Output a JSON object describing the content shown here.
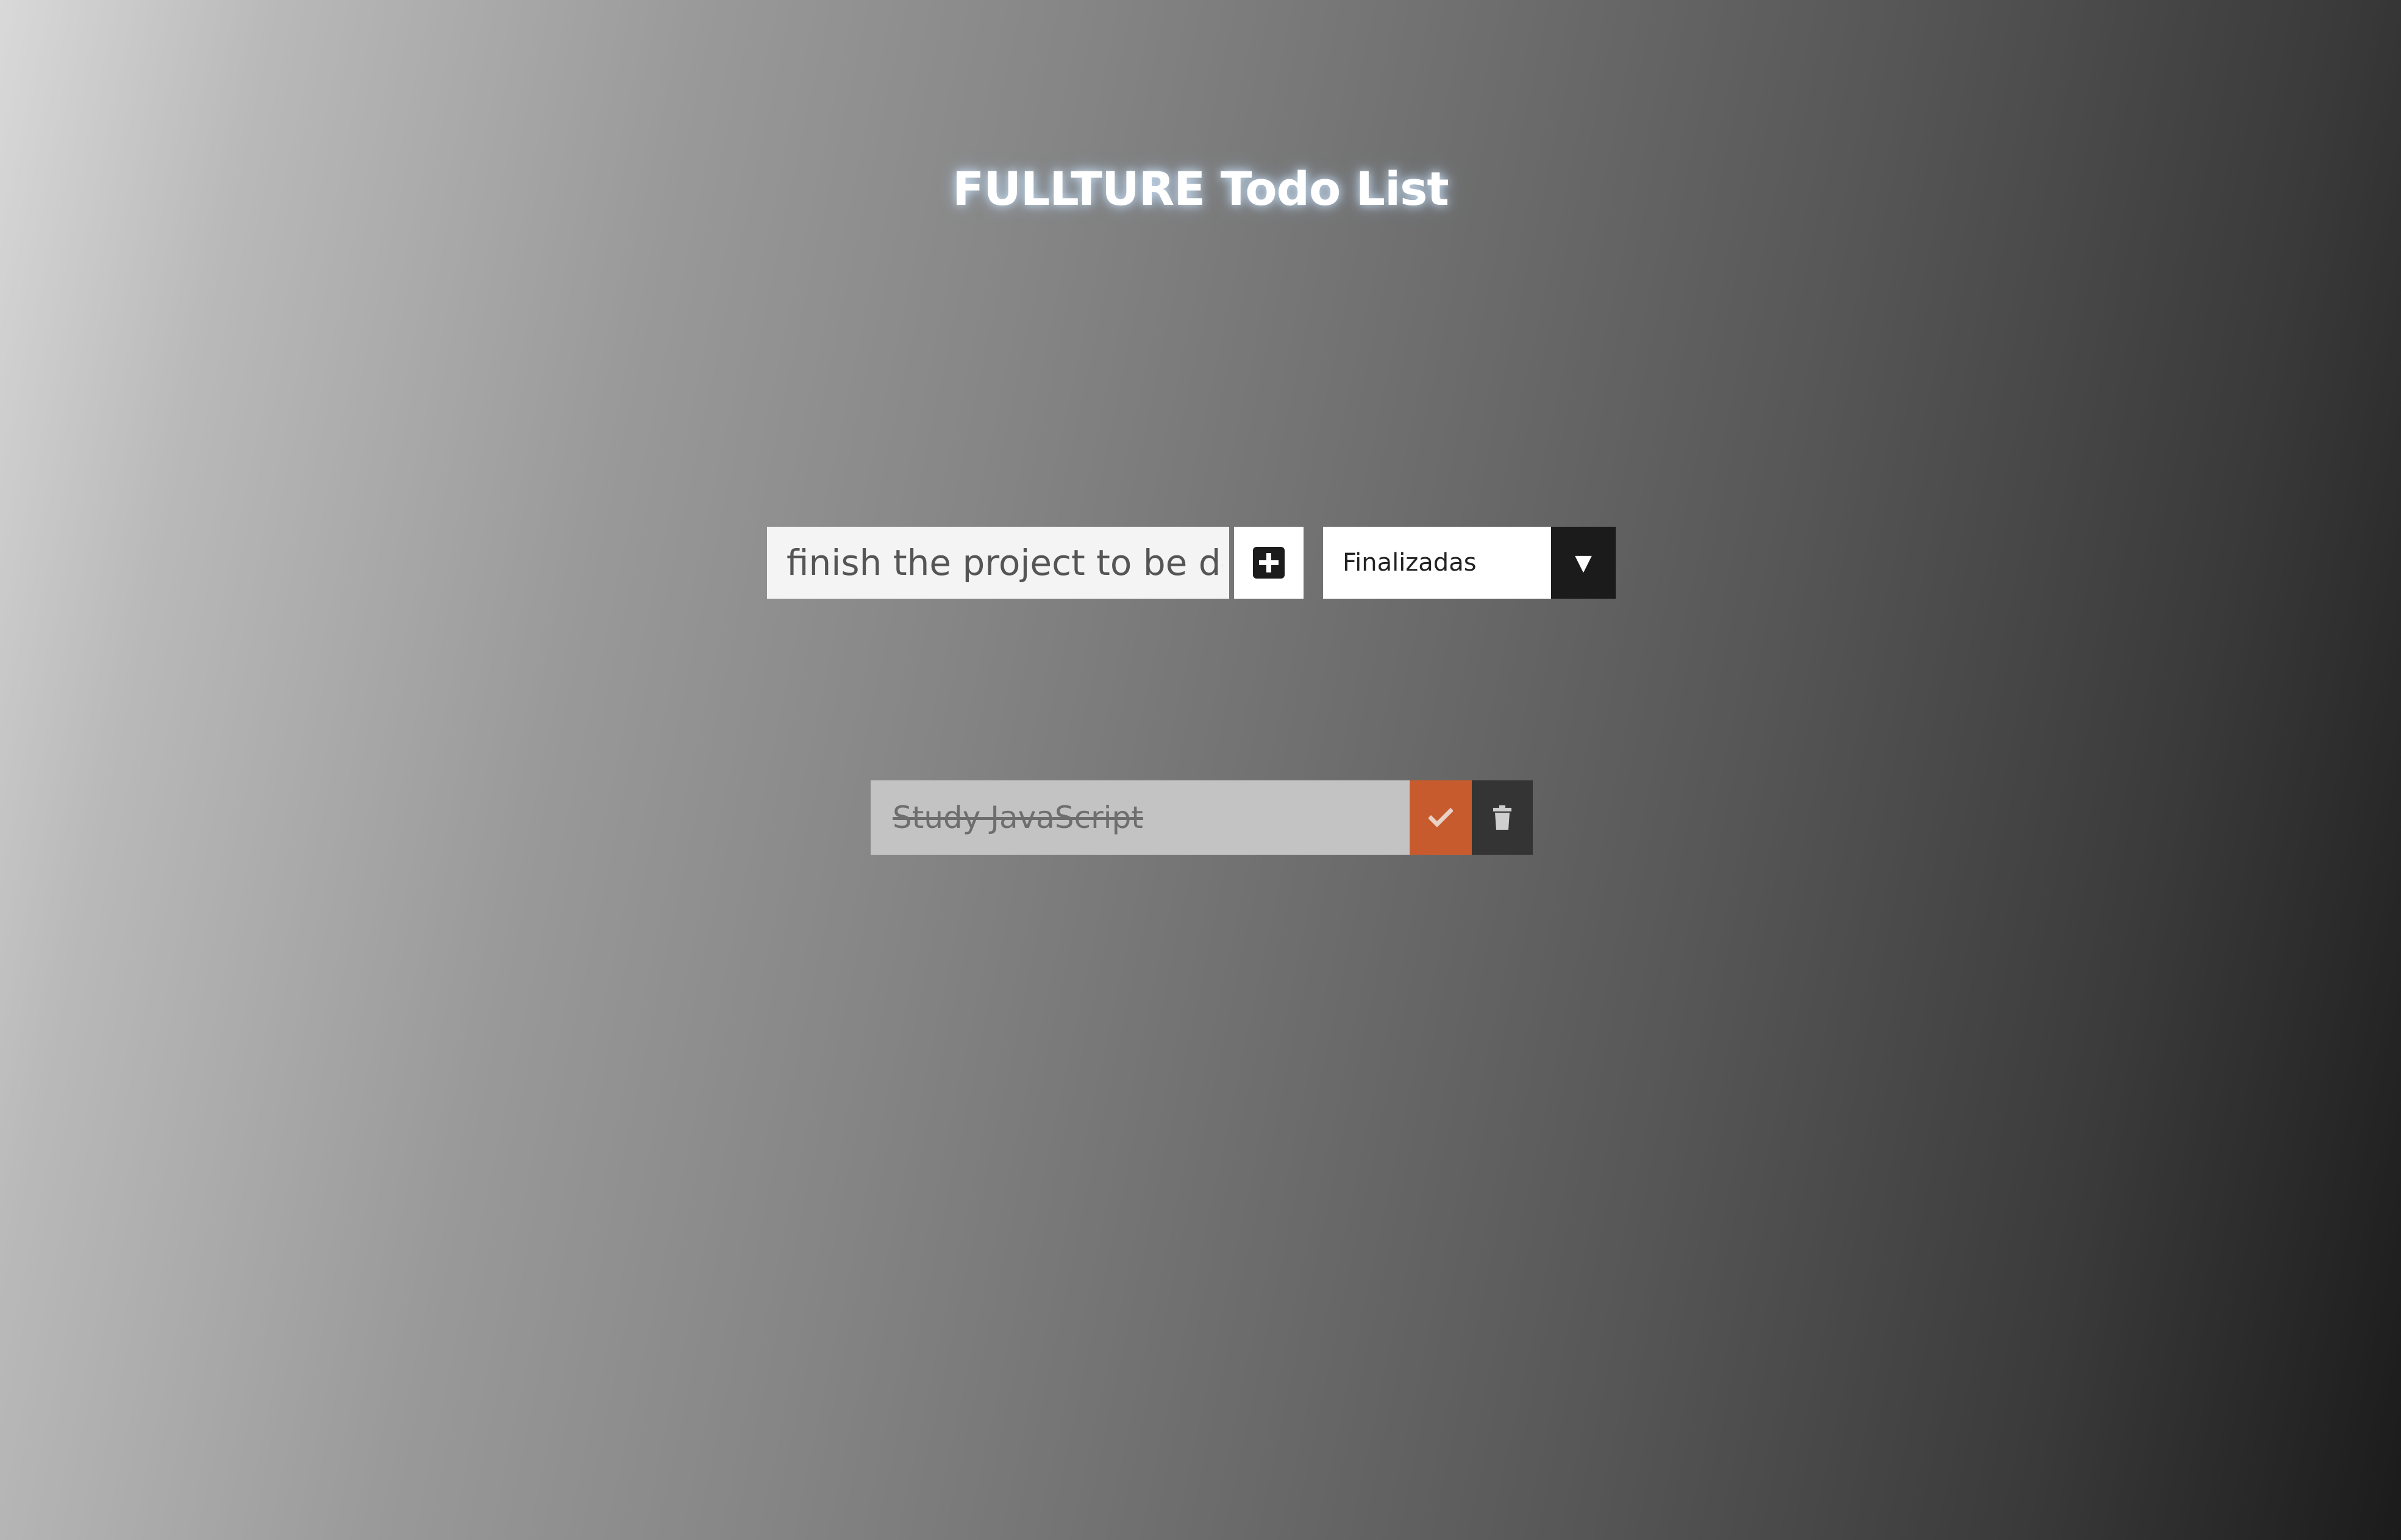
{
  "header": {
    "title": "FULLTURE Todo List"
  },
  "form": {
    "input_value": "finish the project to be delivered",
    "add_icon": "plus-square-icon",
    "filter_selected": "Finalizadas",
    "filter_arrow": "▼"
  },
  "todos": [
    {
      "text": "Study JavaScript",
      "completed": true,
      "complete_icon": "check-icon",
      "delete_icon": "trash-icon"
    }
  ],
  "colors": {
    "complete_button": "#c85b2e",
    "trash_button": "#343434",
    "filter_arrow_bg": "#1b1b1b",
    "title_text": "#ffffff"
  }
}
